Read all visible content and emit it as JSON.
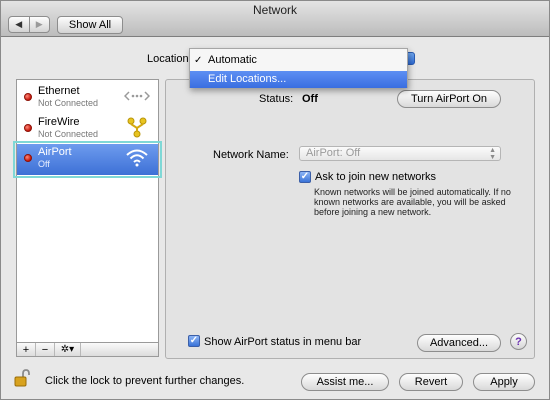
{
  "window": {
    "title": "Network"
  },
  "toolbar": {
    "back": "◀",
    "forward": "▶",
    "show_all": "Show All"
  },
  "location": {
    "label": "Location",
    "menu": {
      "selected_check": "✓",
      "selected": "Automatic",
      "highlighted": "Edit Locations..."
    }
  },
  "services": [
    {
      "name": "Ethernet",
      "status": "Not Connected",
      "status_color": "#c8160a",
      "icon": "ethernet-arrows-icon"
    },
    {
      "name": "FireWire",
      "status": "Not Connected",
      "status_color": "#c8160a",
      "icon": "firewire-icon"
    },
    {
      "name": "AirPort",
      "status": "Off",
      "status_color": "#c8160a",
      "icon": "wifi-icon",
      "selected": true
    }
  ],
  "sidebar_footer": {
    "add": "+",
    "remove": "−",
    "gear": "✲▾"
  },
  "detail": {
    "status_label": "Status:",
    "status_value": "Off",
    "turn_on": "Turn AirPort On",
    "network_name_label": "Network Name:",
    "network_name_value": "AirPort: Off",
    "ask_checked": "✓",
    "ask_label": "Ask to join new networks",
    "ask_description": "Known networks will be joined automatically. If no known networks are available, you will be asked before joining a new network.",
    "show_status_checked": "✓",
    "show_status_label": "Show AirPort status in menu bar",
    "advanced": "Advanced...",
    "help": "?"
  },
  "footer": {
    "lock_text": "Click the lock to prevent further changes.",
    "assist": "Assist me...",
    "revert": "Revert",
    "apply": "Apply"
  },
  "colors": {
    "accent": "#3d70d6",
    "highlight_outline": "#7fd8d6",
    "status_off": "#c8160a"
  }
}
